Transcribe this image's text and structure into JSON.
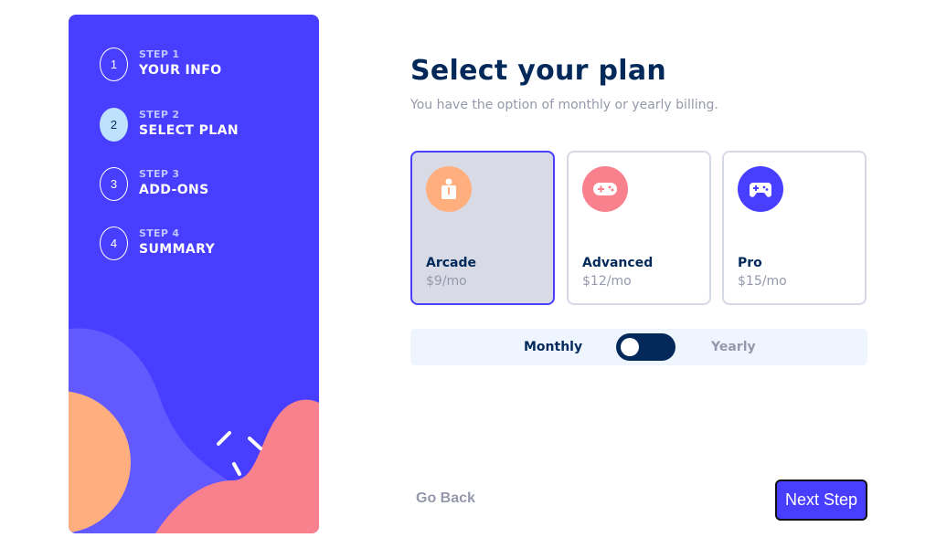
{
  "sidebar": {
    "steps": [
      {
        "num": "1",
        "label": "STEP 1",
        "title": "YOUR INFO"
      },
      {
        "num": "2",
        "label": "STEP 2",
        "title": "SELECT PLAN"
      },
      {
        "num": "3",
        "label": "STEP 3",
        "title": "ADD-ONS"
      },
      {
        "num": "4",
        "label": "STEP 4",
        "title": "SUMMARY"
      }
    ],
    "active_step": 2
  },
  "main": {
    "title": "Select your plan",
    "subtitle": "You have the option of monthly or yearly billing."
  },
  "plans": [
    {
      "name": "Arcade",
      "price": "$9/mo",
      "icon": "arcade-icon",
      "color": "#ffaf7e",
      "selected": true
    },
    {
      "name": "Advanced",
      "price": "$12/mo",
      "icon": "gamepad-icon",
      "color": "#f9818e",
      "selected": false
    },
    {
      "name": "Pro",
      "price": "$15/mo",
      "icon": "controller-icon",
      "color": "#483eff",
      "selected": false
    }
  ],
  "billing": {
    "monthly_label": "Monthly",
    "yearly_label": "Yearly",
    "current": "Monthly"
  },
  "actions": {
    "back_label": "Go Back",
    "next_label": "Next Step"
  },
  "colors": {
    "sidebar_bg": "#483eff",
    "title": "#02295a",
    "muted": "#9699ab",
    "active_step": "#bee2fd",
    "selected_border": "#483eff",
    "toggle_bg": "#02295a"
  }
}
